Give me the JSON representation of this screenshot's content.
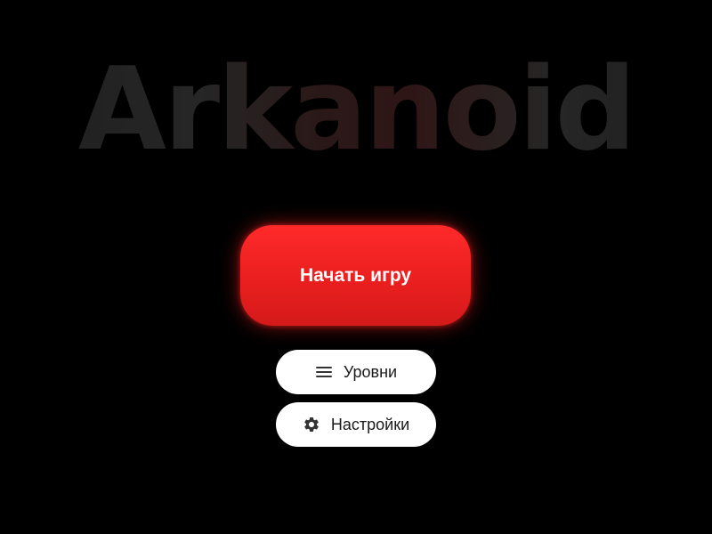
{
  "title": {
    "text": "Arkanoid"
  },
  "menu": {
    "start_label": "Начать игру",
    "levels": {
      "label": "Уровни",
      "icon": "menu-lines-icon"
    },
    "settings": {
      "label": "Настройки",
      "icon": "gear-icon"
    }
  },
  "colors": {
    "background": "#000000",
    "accent": "#ff2222",
    "secondary_button": "#ffffff",
    "secondary_text": "#1a1a1a",
    "title": "#262626"
  }
}
